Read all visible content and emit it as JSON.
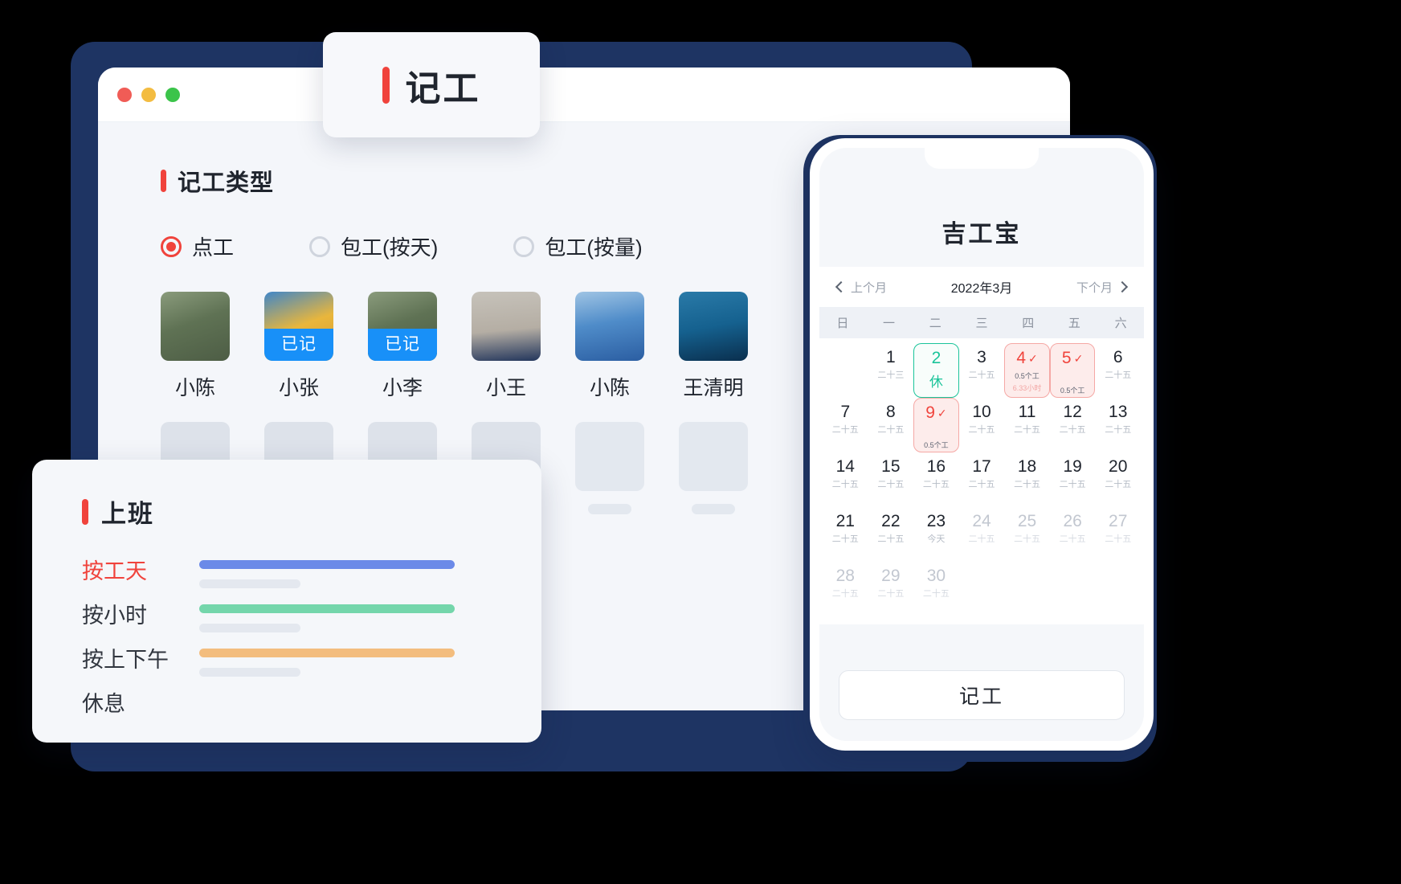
{
  "tab_card": {
    "title": "记工"
  },
  "desktop": {
    "window_dots": [
      "close",
      "minimize",
      "maximize"
    ],
    "section": {
      "title": "记工类型"
    },
    "record_types": [
      {
        "label": "点工",
        "selected": true
      },
      {
        "label": "包工(按天)",
        "selected": false
      },
      {
        "label": "包工(按量)",
        "selected": false
      }
    ],
    "workers": [
      {
        "name": "小陈",
        "badge": "",
        "avatar_colors": [
          "#6d7f63",
          "#9aa48f"
        ]
      },
      {
        "name": "小张",
        "badge": "已记",
        "avatar_colors": [
          "#e8b53c",
          "#2b6fb5"
        ]
      },
      {
        "name": "小李",
        "badge": "已记",
        "avatar_colors": [
          "#6d7f63",
          "#9aa48f"
        ]
      },
      {
        "name": "小王",
        "badge": "",
        "avatar_colors": [
          "#b9b4ac",
          "#2a3d66"
        ]
      },
      {
        "name": "小陈",
        "badge": "",
        "avatar_colors": [
          "#6fa8d6",
          "#2a5ea8"
        ]
      },
      {
        "name": "王清明",
        "badge": "",
        "avatar_colors": [
          "#1d5f8c",
          "#0c3657"
        ]
      }
    ]
  },
  "shift_card": {
    "title": "上班",
    "items": [
      {
        "label": "按工天",
        "active": true,
        "color": "#6b8ae8"
      },
      {
        "label": "按小时",
        "active": false,
        "color": "#74d6ab"
      },
      {
        "label": "按上下午",
        "active": false,
        "color": "#f3bd7e"
      },
      {
        "label": "休息",
        "active": false,
        "color": ""
      }
    ]
  },
  "phone": {
    "app_title": "吉工宝",
    "nav": {
      "prev": "上个月",
      "month": "2022年3月",
      "next": "下个月"
    },
    "weekdays": [
      "日",
      "一",
      "二",
      "三",
      "四",
      "五",
      "六"
    ],
    "action_button": "记工",
    "days": [
      {
        "num": "",
        "sub": "",
        "state": "empty"
      },
      {
        "num": "1",
        "sub": "二十三",
        "state": "normal"
      },
      {
        "num": "2",
        "sub": "",
        "state": "rest",
        "note": "休"
      },
      {
        "num": "3",
        "sub": "二十五",
        "state": "normal"
      },
      {
        "num": "4",
        "sub": "",
        "state": "work",
        "check": true,
        "note": "0.5个工",
        "note2": "6.33小时"
      },
      {
        "num": "5",
        "sub": "",
        "state": "work",
        "check": true,
        "note": "0.5个工"
      },
      {
        "num": "6",
        "sub": "二十五",
        "state": "normal"
      },
      {
        "num": "7",
        "sub": "二十五",
        "state": "normal"
      },
      {
        "num": "8",
        "sub": "二十五",
        "state": "normal"
      },
      {
        "num": "9",
        "sub": "",
        "state": "work",
        "check": true,
        "note": "0.5个工"
      },
      {
        "num": "10",
        "sub": "二十五",
        "state": "normal"
      },
      {
        "num": "11",
        "sub": "二十五",
        "state": "normal"
      },
      {
        "num": "12",
        "sub": "二十五",
        "state": "normal"
      },
      {
        "num": "13",
        "sub": "二十五",
        "state": "normal"
      },
      {
        "num": "14",
        "sub": "二十五",
        "state": "normal"
      },
      {
        "num": "15",
        "sub": "二十五",
        "state": "normal"
      },
      {
        "num": "16",
        "sub": "二十五",
        "state": "normal"
      },
      {
        "num": "17",
        "sub": "二十五",
        "state": "normal"
      },
      {
        "num": "18",
        "sub": "二十五",
        "state": "normal"
      },
      {
        "num": "19",
        "sub": "二十五",
        "state": "normal"
      },
      {
        "num": "20",
        "sub": "二十五",
        "state": "normal"
      },
      {
        "num": "21",
        "sub": "二十五",
        "state": "normal"
      },
      {
        "num": "22",
        "sub": "二十五",
        "state": "normal"
      },
      {
        "num": "23",
        "sub": "今天",
        "state": "normal"
      },
      {
        "num": "24",
        "sub": "二十五",
        "state": "muted"
      },
      {
        "num": "25",
        "sub": "二十五",
        "state": "muted"
      },
      {
        "num": "26",
        "sub": "二十五",
        "state": "muted"
      },
      {
        "num": "27",
        "sub": "二十五",
        "state": "muted"
      },
      {
        "num": "28",
        "sub": "二十五",
        "state": "muted"
      },
      {
        "num": "29",
        "sub": "二十五",
        "state": "muted"
      },
      {
        "num": "30",
        "sub": "二十五",
        "state": "muted"
      },
      {
        "num": "",
        "sub": "",
        "state": "empty"
      },
      {
        "num": "",
        "sub": "",
        "state": "empty"
      },
      {
        "num": "",
        "sub": "",
        "state": "empty"
      },
      {
        "num": "",
        "sub": "",
        "state": "empty"
      }
    ]
  },
  "colors": {
    "accent_red": "#f0433c",
    "brand_navy": "#1e3463",
    "badge_blue": "#1890f8",
    "rest_green": "#1bc49a"
  }
}
